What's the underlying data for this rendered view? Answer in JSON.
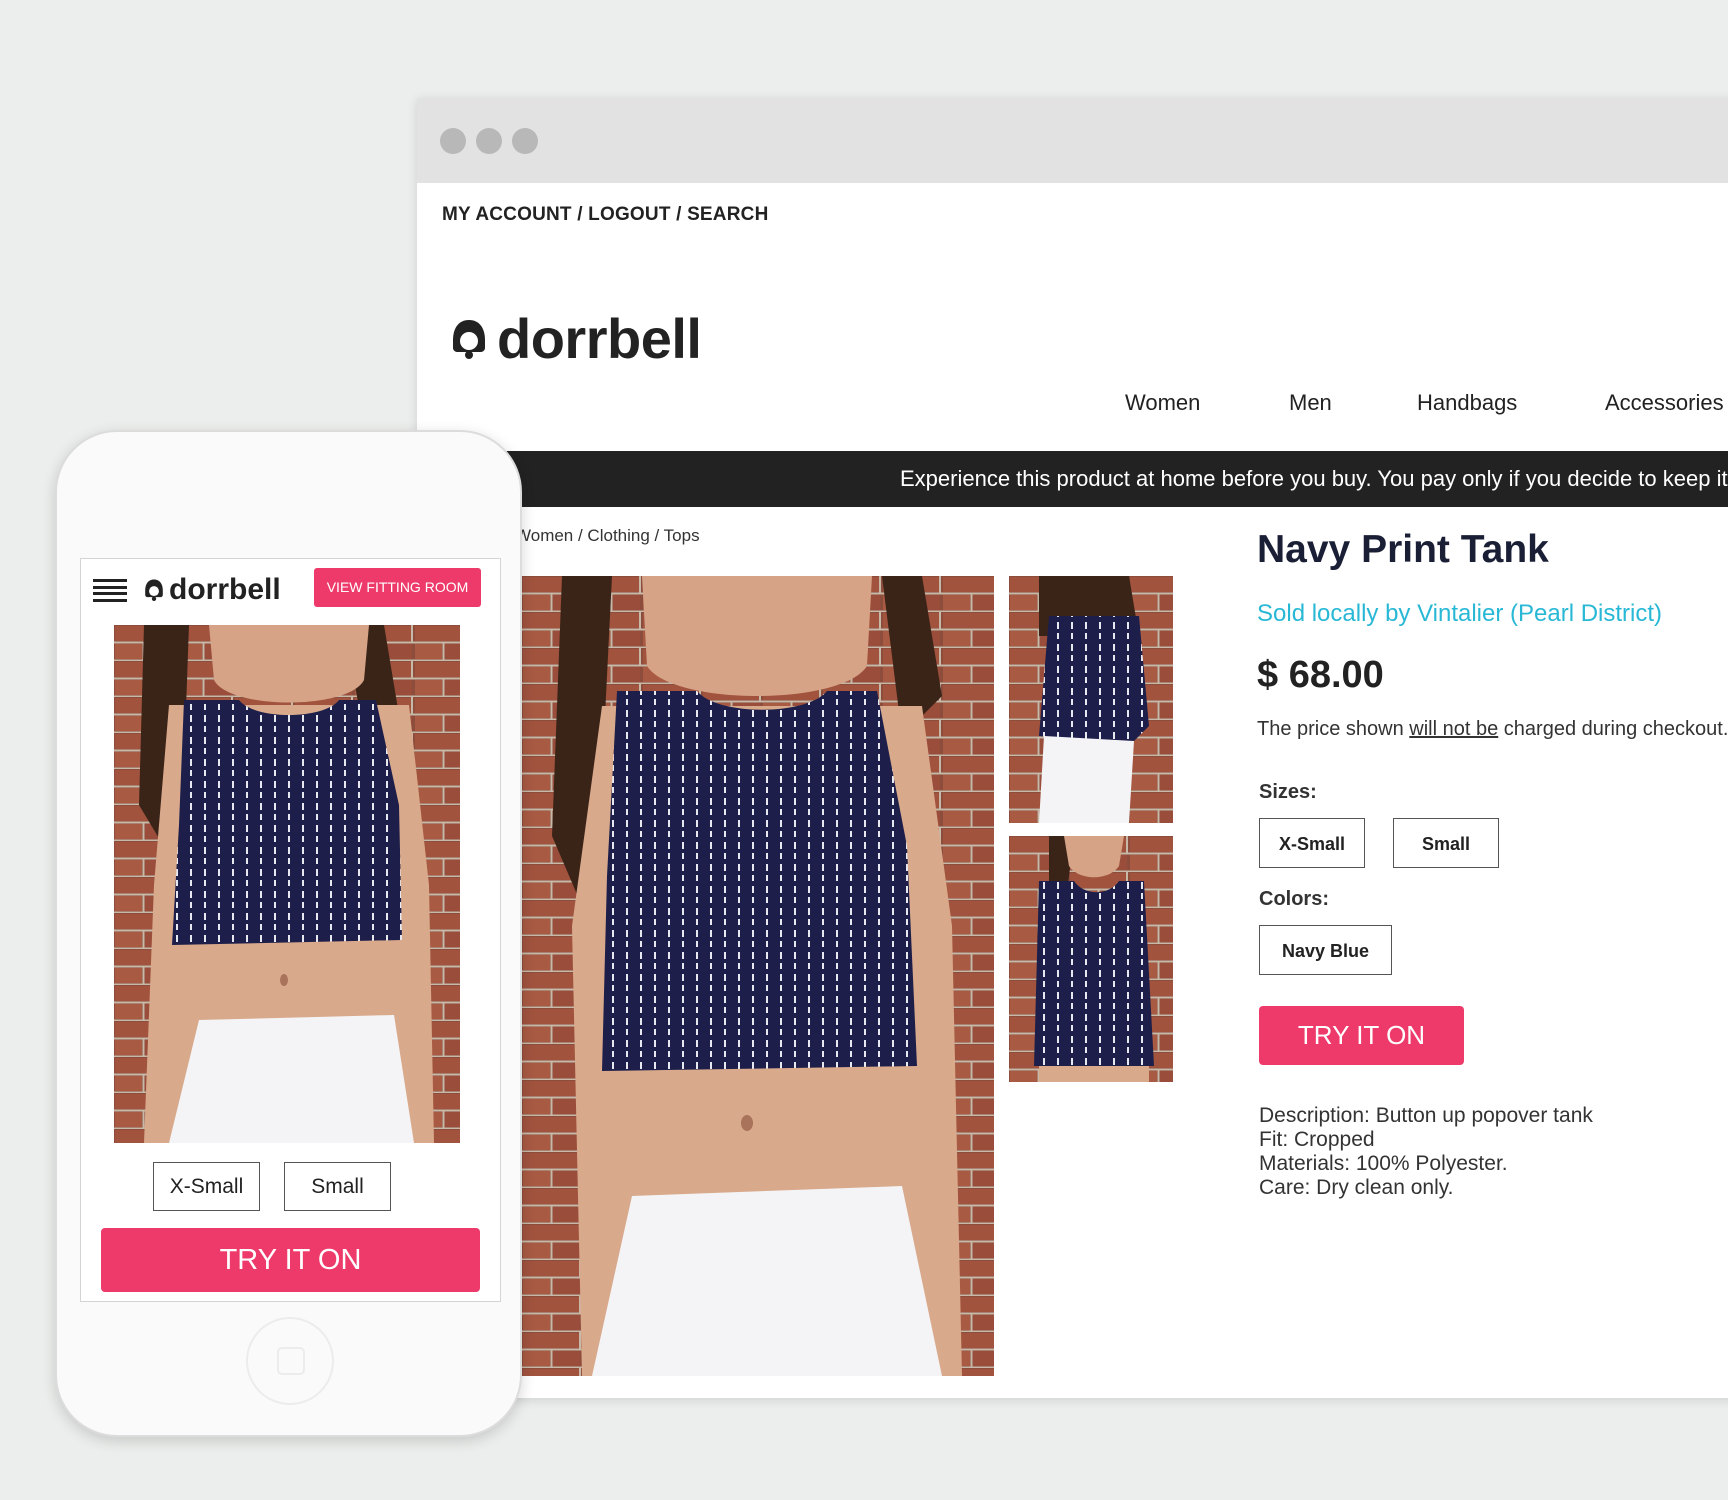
{
  "desktop": {
    "account_links": "MY ACCOUNT / LOGOUT / SEARCH",
    "brand": "dorrbell",
    "nav": [
      "Women",
      "Men",
      "Handbags",
      "Accessories"
    ],
    "banner": "Experience this product at home before you buy. You pay only if you decide to keep it.",
    "breadcrumb": "Women / Clothing / Tops",
    "product": {
      "title": "Navy Print Tank",
      "seller": "Sold locally by Vintalier (Pearl District)",
      "price": "$ 68.00",
      "note_pre": "The price shown ",
      "note_emph": "will not be",
      "note_post": " charged during checkout.",
      "sizes_label": "Sizes:",
      "sizes": [
        "X-Small",
        "Small"
      ],
      "colors_label": "Colors:",
      "colors": [
        "Navy Blue"
      ],
      "try_label": "TRY IT ON",
      "description": [
        "Description: Button up popover tank",
        "Fit: Cropped",
        "Materials: 100% Polyester.",
        "Care: Dry clean only."
      ]
    }
  },
  "mobile": {
    "brand": "dorrbell",
    "view_fitting_room": "VIEW FITTING ROOM",
    "sizes": [
      "X-Small",
      "Small"
    ],
    "try_label": "TRY IT ON"
  },
  "colors": {
    "accent": "#ee3a6a",
    "seller_link": "#28b8d6",
    "banner_bg": "#222222",
    "garment": "#1d1f4a"
  }
}
